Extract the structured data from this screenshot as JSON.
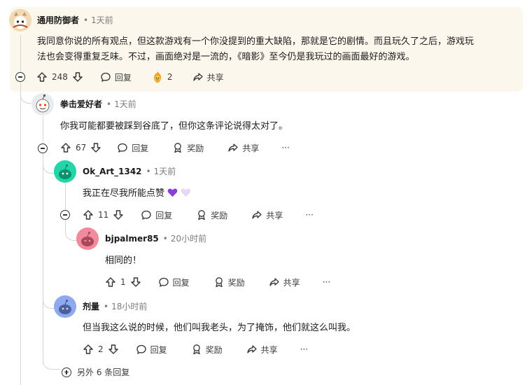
{
  "comments": [
    {
      "user": "通用防御者",
      "time": "1天前",
      "lines": [
        "我同意你说的所有观点，但这款游戏有一个你没提到的重大缺陷，那就是它的剧情。而且玩久了之后，游戏玩",
        "法也会变得重复乏味。不过，画面绝对是一流的，《暗影》至今仍是我玩过的画面最好的游戏。"
      ],
      "votes": "248",
      "reply_label": "回复",
      "award_count": "2",
      "share_label": "共享",
      "avatar_color": "#f0d9b5"
    },
    {
      "user": "拳击爱好者",
      "time": "1天前",
      "text": "你我可能都要被踩到谷底了，但你这条评论说得太对了。",
      "votes": "67",
      "reply_label": "回复",
      "award_label": "奖励",
      "share_label": "共享",
      "more": "···",
      "avatar_color": "#e9ecef"
    },
    {
      "user": "Ok_Art_1342",
      "time": "1天前",
      "text": "我正在尽我所能点赞",
      "votes": "11",
      "reply_label": "回复",
      "award_label": "奖励",
      "share_label": "共享",
      "more": "···",
      "avatar_color": "#22d6a8"
    },
    {
      "user": "bjpalmer85",
      "time": "20小时前",
      "text": "相同的！",
      "votes": "1",
      "reply_label": "回复",
      "award_label": "奖励",
      "share_label": "共享",
      "more": "···",
      "avatar_color": "#f08a9c"
    },
    {
      "user": "剂量",
      "time": "18小时前",
      "text": "但当我这么说的时候，他们叫我老头，为了掩饰，他们就这么叫我。",
      "votes": "2",
      "reply_label": "回复",
      "award_label": "奖励",
      "share_label": "共享",
      "more": "···",
      "avatar_color": "#8fa9f0"
    }
  ],
  "more_replies": "另外 6 条回复",
  "colors": {
    "highlight_bg": "#fcf7ed",
    "thread_line": "#d0d5da",
    "purple_heart": "#8b3fd9",
    "light_heart": "#d9c8f5"
  }
}
